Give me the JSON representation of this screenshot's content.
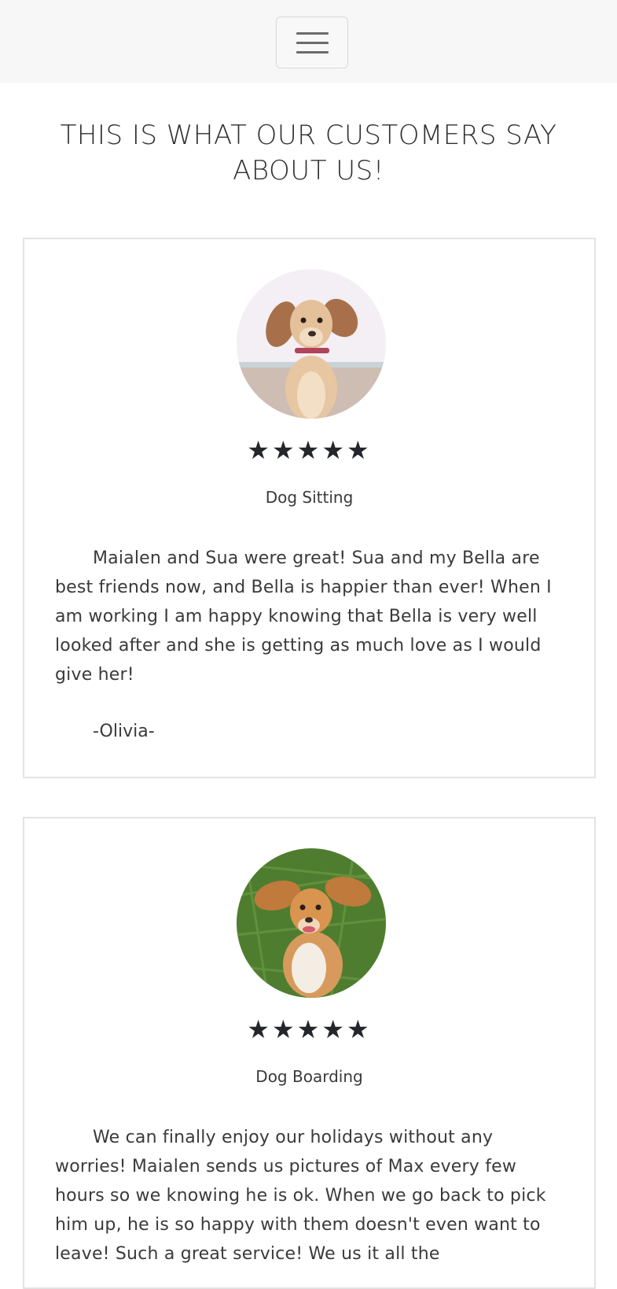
{
  "header": {
    "menu_icon": "hamburger-menu-icon"
  },
  "page": {
    "title": "THIS IS WHAT OUR CUSTOMERS SAY ABOUT US!"
  },
  "testimonials": [
    {
      "photo_icon": "dog-photo",
      "rating": 5,
      "stars": "★★★★★",
      "service": "Dog Sitting",
      "text": "Maialen and Sua were great! Sua and my Bella are best friends now, and Bella is happier than ever! When I am working I am happy knowing that Bella is very well looked after and she is getting as much love as I would give her!",
      "author": "-Olivia-"
    },
    {
      "photo_icon": "dog-photo",
      "rating": 5,
      "stars": "★★★★★",
      "service": "Dog Boarding",
      "text": "We can finally enjoy our holidays without any worries! Maialen sends us pictures of Max every few hours so we knowing he is ok. When we go back to pick him up, he is so happy with them doesn't even want to leave! Such a great service! We us it all the"
    }
  ],
  "colors": {
    "header_bg": "#f7f7f7",
    "card_border": "#e3e3e3",
    "star": "#23272b",
    "text": "#3a3a3a"
  }
}
